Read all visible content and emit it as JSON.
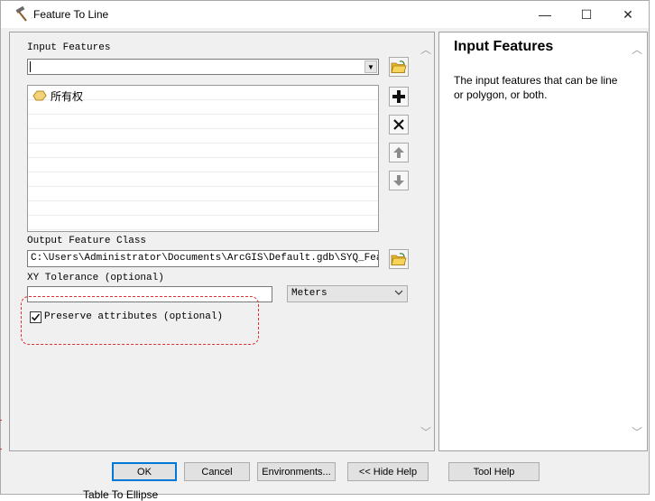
{
  "window": {
    "title": "Feature To Line",
    "title_icon": "hammer-icon"
  },
  "controls": {
    "minimize": "—",
    "maximize": "☐",
    "close": "✕"
  },
  "form": {
    "input_features_label": "Input Features",
    "input_features_value": "",
    "list_items": [
      {
        "label": "所有权",
        "icon": "polygon-layer-icon"
      }
    ],
    "output_label": "Output Feature Class",
    "output_value": "C:\\Users\\Administrator\\Documents\\ArcGIS\\Default.gdb\\SYQ_FeatureT",
    "xy_label": "XY Tolerance (optional)",
    "xy_value": "",
    "units_value": "Meters",
    "preserve_label": "Preserve attributes (optional)",
    "preserve_checked": true
  },
  "help": {
    "title": "Input Features",
    "text": "The input features that can be line or polygon, or both."
  },
  "buttons": {
    "ok": "OK",
    "cancel": "Cancel",
    "environments": "Environments...",
    "hide_help": "<< Hide Help",
    "tool_help": "Tool Help"
  },
  "background": {
    "behind_label": "Table To Ellipse"
  },
  "colors": {
    "highlight_dash": "#e03030",
    "default_button_border": "#0078d7"
  }
}
